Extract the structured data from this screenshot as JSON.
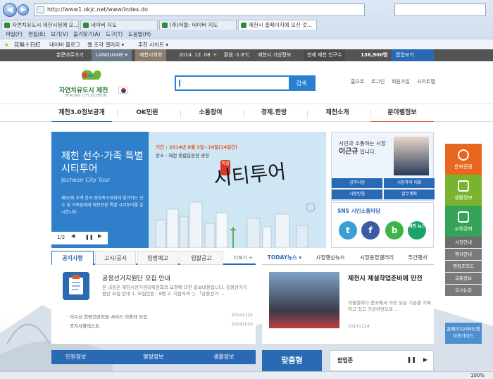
{
  "browser": {
    "url": "http://www1.okjc.net/www/index.do",
    "tabs": [
      {
        "label": "자연치유도시 제천시청에 오..."
      },
      {
        "label": "네이버 지도"
      },
      {
        "label": "(주)어들: 네이버 지도"
      },
      {
        "label": "제천시 홈페이지에 오신 것..."
      }
    ],
    "menu": [
      "파일(F)",
      "편집(E)",
      "보기(V)",
      "즐겨찾기(A)",
      "도구(T)",
      "도움말(H)"
    ],
    "favorites": [
      "花無十日紅",
      "네이버 블로그",
      "웹 조각 갤러리 ▾",
      "추천 사이트 ▾"
    ],
    "zoom": "100%"
  },
  "topbar": {
    "home_shortcut": "본문바로가기",
    "language": "LANGUAGE ▾",
    "city_link": "제천시의회",
    "date": "2014. 12. 08",
    "weather": "맑음 -1.8℃",
    "weather_info": "제천시 기상정보",
    "population_label": "현재 제천 인구수",
    "population_value": "136,900명",
    "popup_view": "팝업보기"
  },
  "header": {
    "logo_text": "자연치유도시 제천",
    "logo_sub": "HEALING CITY JECHEON",
    "search_button": "검색",
    "util_links": [
      "홈으로",
      "로그인",
      "회원가입",
      "사이트맵"
    ]
  },
  "gnb": [
    "제천3.0정보공개",
    "OK민원",
    "소통참여",
    "경제.한방",
    "제천소개",
    "분야별정보"
  ],
  "banner": {
    "title": "제천 선수·가족 특별시티투어",
    "subtitle": "Jecheon City Tour",
    "description": "제50회 추계 한국 중등축구대회에 참가하는 선수 및 가족들에게 제천관광 특별 시티투어를 실시합니다.",
    "period": "기간 : 2014년 8월 3일~16일(14일간)",
    "place": "장소 : 제천 종합운동장 광장",
    "tour_label": "시티투어",
    "tour_badge": "특별",
    "page": "1/2",
    "pause": "❚❚",
    "prev": "◀",
    "next": "▶"
  },
  "mayor": {
    "msg_line1": "시민과 소통하는 시장",
    "name": "이근규",
    "msg_line2": "입니다.",
    "buttons": [
      "공약사업",
      "시장과의 대화",
      "시장방침",
      "업무계획"
    ]
  },
  "sns": {
    "title": "SNS 시민소통마당",
    "icons": [
      {
        "name": "twitter-icon",
        "glyph": "t",
        "color": "#3a9fd6"
      },
      {
        "name": "facebook-icon",
        "glyph": "f",
        "color": "#3b5ba8"
      },
      {
        "name": "blog-icon",
        "glyph": "b",
        "color": "#3cb449"
      },
      {
        "name": "jecheon-news-icon",
        "glyph": "뉴",
        "color": "#1aa36a"
      }
    ],
    "jecheon_news": "제천 뉴스"
  },
  "notice": {
    "tabs": [
      "공지사항",
      "고시/공시",
      "입법예고",
      "입찰공고"
    ],
    "more": "더보기 +",
    "feature_title": "공정선거지원단 모집 안내",
    "feature_desc": "본 내용은 제천시선거관리위원회의 요청에 의한 홍보내용입니다. 공정선거지원단 모집 안내 1. 모집인원 : 8명 2. 지원자격 ○ 「공중선거 ...",
    "items": [
      {
        "title": "· 어르신 한방건강지원 서비스 이용자 모집",
        "date": "20141124"
      },
      {
        "title": "· 공지사항테스트",
        "date": "20141029"
      }
    ]
  },
  "news": {
    "tabs": [
      "TODAY뉴스 ▾",
      "시정행상뉴스",
      "시정동정갤러리",
      "주간행사"
    ],
    "title": "제천시 제설작업준비에 만전",
    "desc": "겨울철마다 전국에서 가장 낮은 기온을 기록하고 있고 기상이변으로 ...",
    "date": "20141124"
  },
  "quick": [
    {
      "label": "문화관광",
      "color": "#e8661d"
    },
    {
      "label": "생활정보",
      "color": "#7ab32e"
    },
    {
      "label": "교육강좌",
      "color": "#35a25a"
    }
  ],
  "quick_small": [
    "시장안내",
    "행사안내",
    "행정조직도",
    "교통정보",
    "오시는길",
    "홈페이지/SNS/앱 이용가이드"
  ],
  "bottom": {
    "min_won": "민원정보",
    "admin": "행정정보",
    "life": "생활정보",
    "customized": "맞춤형",
    "popup_zone": "팝업존"
  }
}
